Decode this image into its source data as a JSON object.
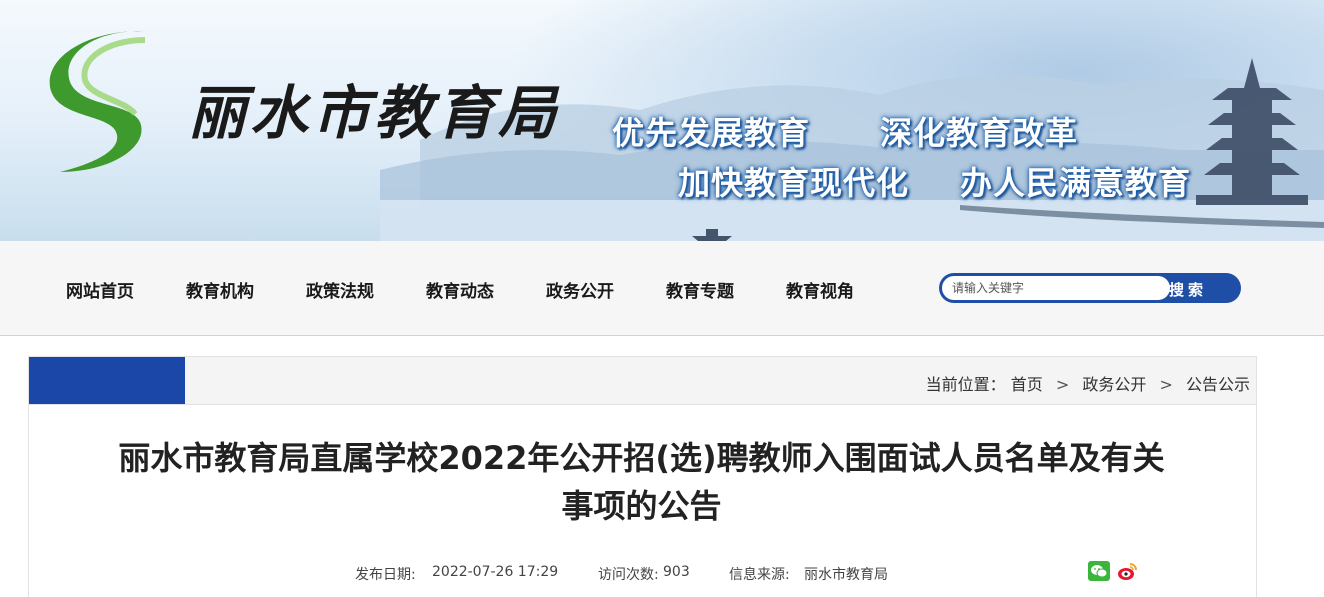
{
  "header": {
    "site_title": "丽水市教育局",
    "slogans": [
      "优先发展教育",
      "深化教育改革",
      "加快教育现代化",
      "办人民满意教育"
    ]
  },
  "nav": {
    "items": [
      "网站首页",
      "教育机构",
      "政策法规",
      "教育动态",
      "政务公开",
      "教育专题",
      "教育视角"
    ]
  },
  "search": {
    "placeholder": "请输入关键字",
    "button_label": "搜索"
  },
  "breadcrumb": {
    "prefix": "当前位置：",
    "items": [
      "首页",
      "政务公开",
      "公告公示"
    ],
    "separator": ">"
  },
  "article": {
    "title_line1": "丽水市教育局直属学校2022年公开招(选)聘教师入围面试人员名单及有关",
    "title_line2": "事项的公告",
    "publish_label": "发布日期:",
    "publish_date": "2022-07-26  17:29",
    "views_label": "访问次数:",
    "views": "903",
    "source_label": "信息来源:",
    "source": "丽水市教育局"
  },
  "share": {
    "icons": [
      "wechat-icon",
      "weibo-icon"
    ]
  },
  "colors": {
    "brand_blue": "#1b47a8",
    "search_blue": "#1e4ea6",
    "logo_green": "#3f9a2e"
  }
}
